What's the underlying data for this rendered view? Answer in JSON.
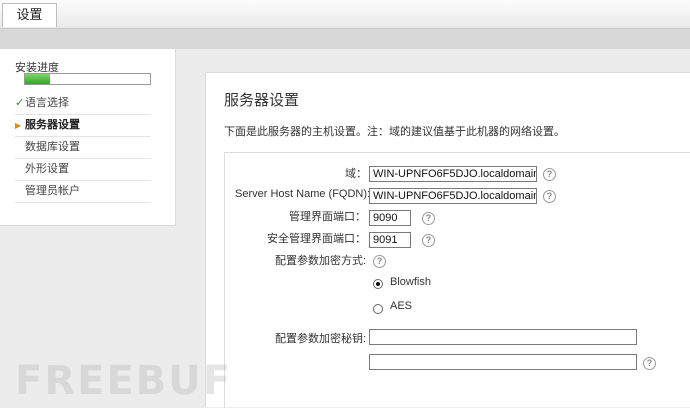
{
  "top_tab": {
    "label": "设置"
  },
  "sidebar": {
    "progress_label": "安装进度",
    "progress_fraction": 0.2,
    "steps": [
      {
        "label": "语言选择",
        "state": "done"
      },
      {
        "label": "服务器设置",
        "state": "current"
      },
      {
        "label": "数据库设置",
        "state": "pending"
      },
      {
        "label": "外形设置",
        "state": "pending"
      },
      {
        "label": "管理员帐户",
        "state": "pending"
      }
    ],
    "check_mark": "✓",
    "arrow_mark": "▶"
  },
  "main": {
    "title": "服务器设置",
    "description": "下面是此服务器的主机设置。注：域的建议值基于此机器的网络设置。",
    "form": {
      "domain_label": "域：",
      "domain_value": "WIN-UPNFO6F5DJO.localdomain",
      "fqdn_label": "Server Host Name (FQDN):",
      "fqdn_value": "WIN-UPNFO6F5DJO.localdomain",
      "admin_port_label": "管理界面端口：",
      "admin_port_value": "9090",
      "secure_port_label": "安全管理界面端口：",
      "secure_port_value": "9091",
      "encryption_label": "配置参数加密方式:",
      "option_blowfish": "Blowfish",
      "option_aes": "AES",
      "selected_option": "Blowfish",
      "key_label": "配置参数加密秘钥:",
      "key_value": "",
      "key_confirm_value": "",
      "help_glyph": "?"
    }
  },
  "watermark": "FREEBUF"
}
